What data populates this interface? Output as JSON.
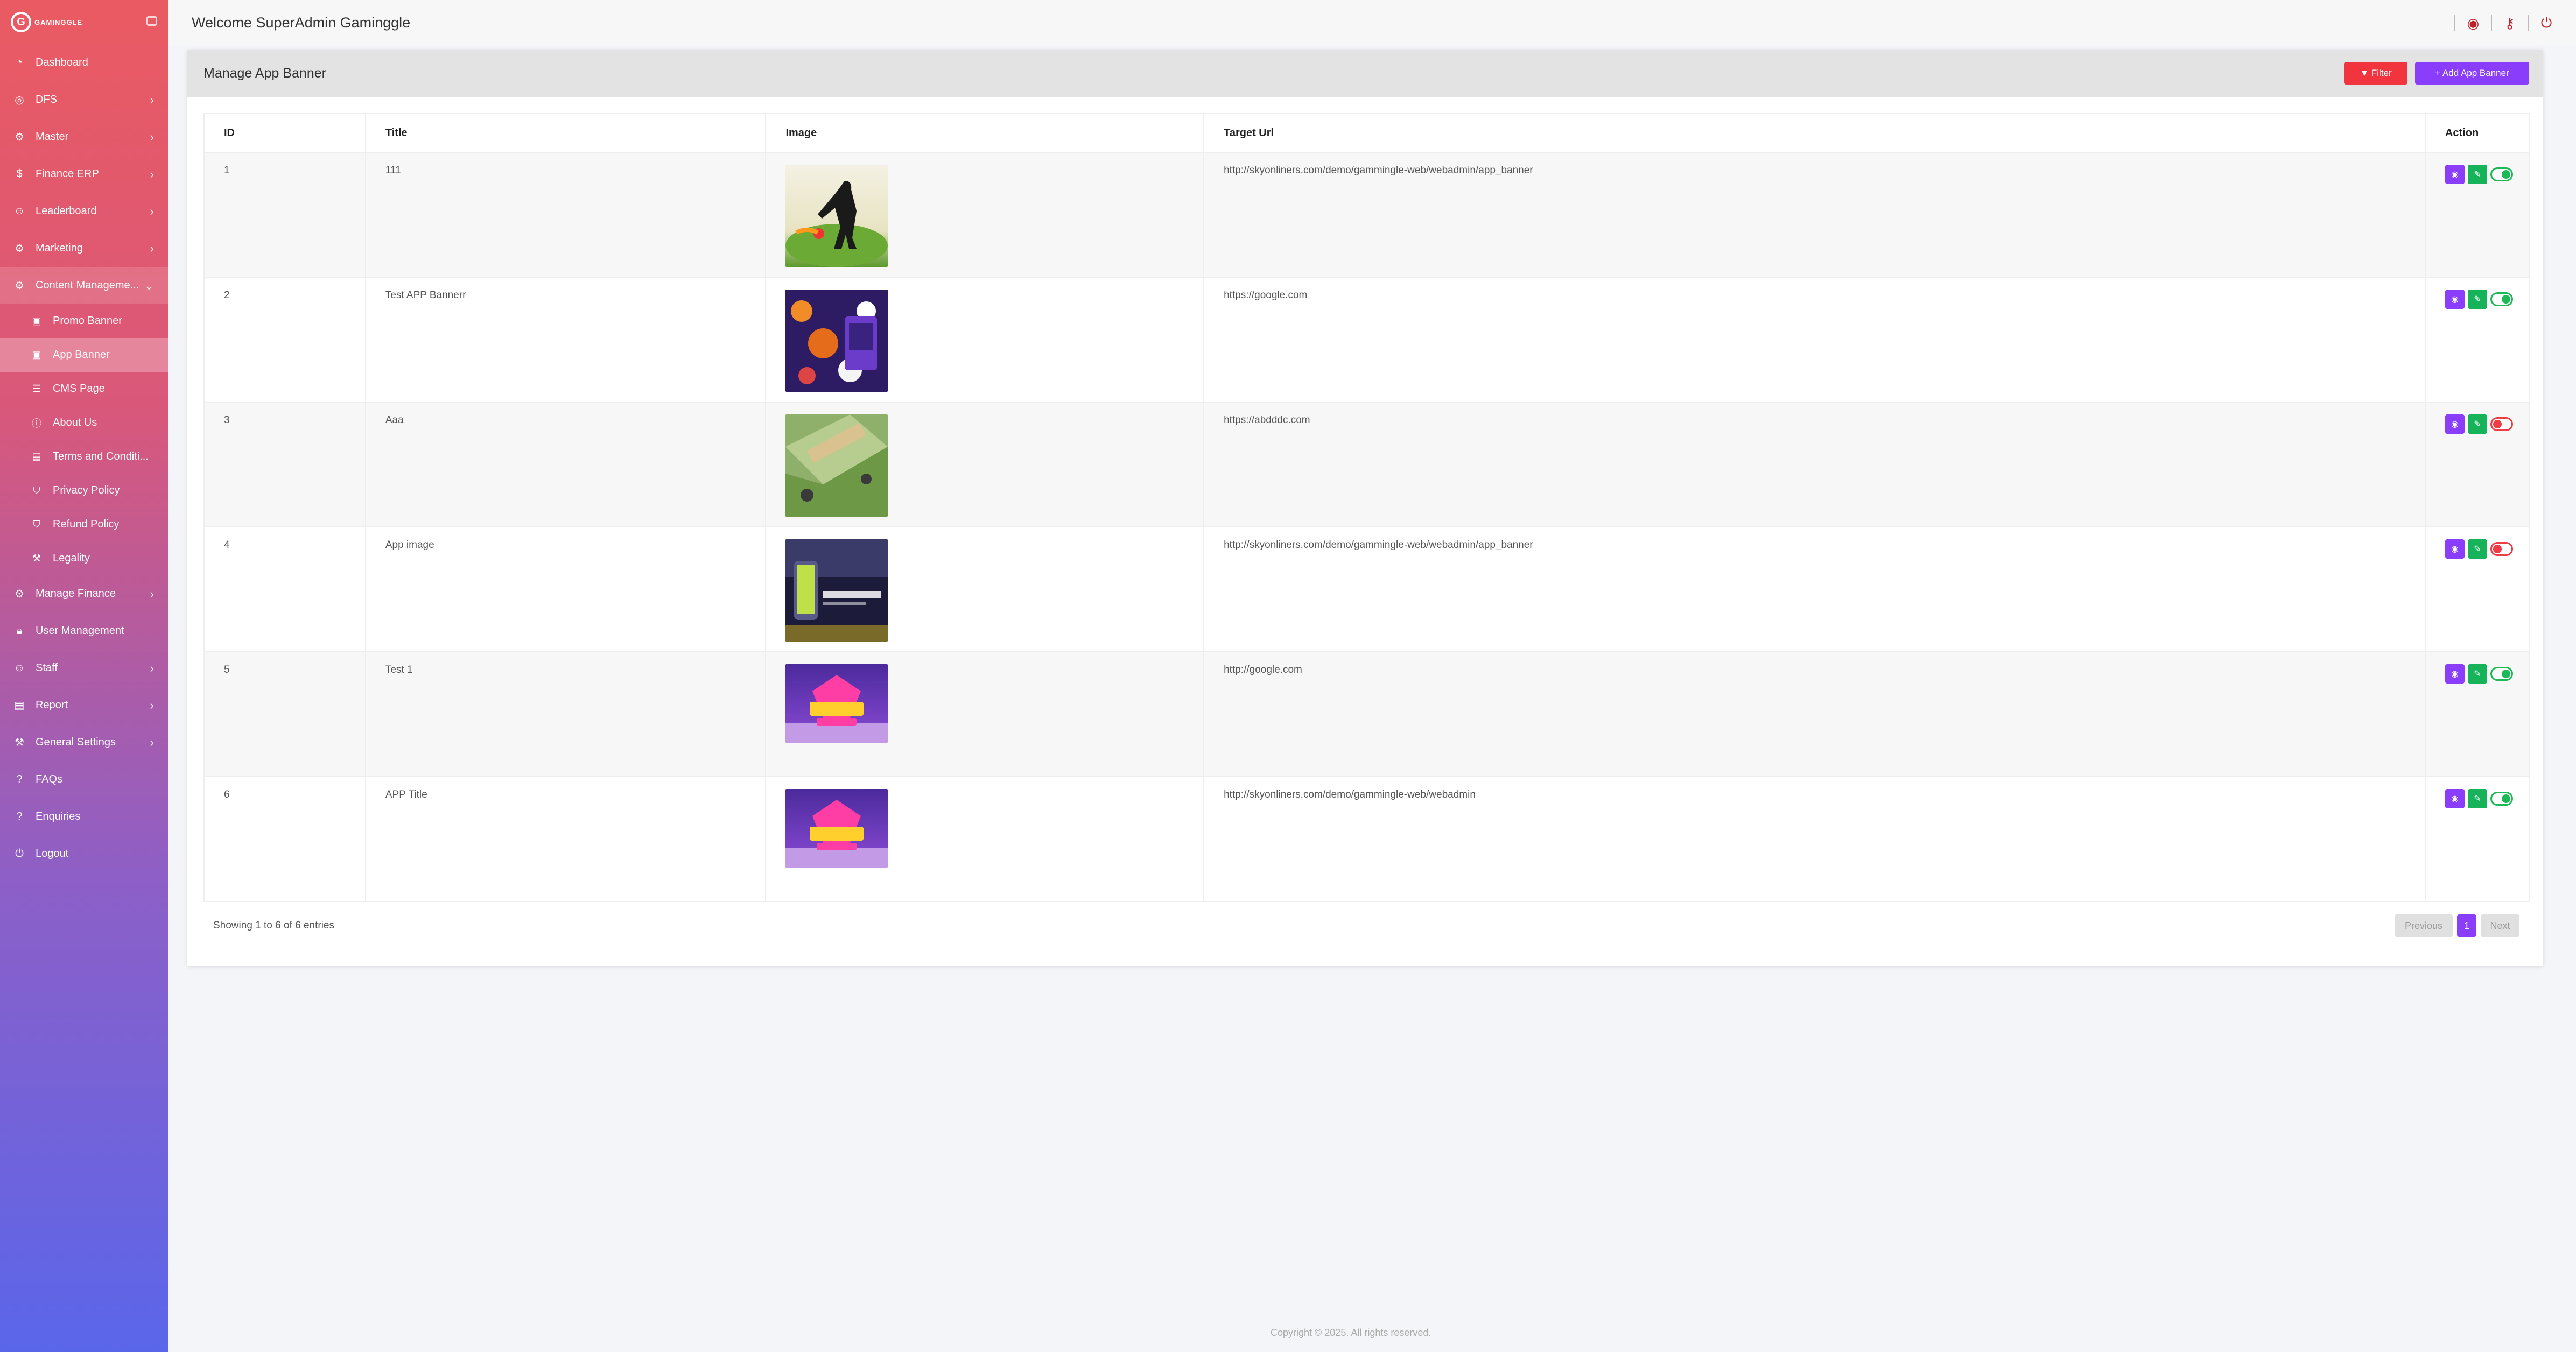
{
  "brand": {
    "logo_letter": "G",
    "name": "GAMINGGLE"
  },
  "header": {
    "welcome": "Welcome SuperAdmin Gaminggle"
  },
  "sidebar": {
    "items": [
      {
        "label": "Dashboard",
        "icon": "dashboard-icon"
      },
      {
        "label": "DFS",
        "icon": "dfs-icon"
      },
      {
        "label": "Master",
        "icon": "gears-icon"
      },
      {
        "label": "Finance ERP",
        "icon": "dollar-icon"
      },
      {
        "label": "Leaderboard",
        "icon": "users-icon"
      },
      {
        "label": "Marketing",
        "icon": "gears-icon"
      },
      {
        "label": "Content Manageme...",
        "icon": "gears-icon"
      },
      {
        "label": "Manage Finance",
        "icon": "gears-icon"
      },
      {
        "label": "User Management",
        "icon": "lock-icon"
      },
      {
        "label": "Staff",
        "icon": "user-icon"
      },
      {
        "label": "Report",
        "icon": "report-icon"
      },
      {
        "label": "General Settings",
        "icon": "wrench-icon"
      },
      {
        "label": "FAQs",
        "icon": "question-icon"
      },
      {
        "label": "Enquiries",
        "icon": "question-icon"
      },
      {
        "label": "Logout",
        "icon": "power-icon"
      }
    ],
    "content_sub": [
      {
        "label": "Promo Banner",
        "icon": "image-icon"
      },
      {
        "label": "App Banner",
        "icon": "image-icon"
      },
      {
        "label": "CMS Page",
        "icon": "list-icon"
      },
      {
        "label": "About Us",
        "icon": "info-icon"
      },
      {
        "label": "Terms and Conditi...",
        "icon": "document-icon"
      },
      {
        "label": "Privacy Policy",
        "icon": "shield-icon"
      },
      {
        "label": "Refund Policy",
        "icon": "shield-icon"
      },
      {
        "label": "Legality",
        "icon": "gavel-icon"
      }
    ]
  },
  "page": {
    "title": "Manage App Banner",
    "filter_label": "Filter",
    "add_label": "+ Add App Banner"
  },
  "table": {
    "columns": [
      "ID",
      "Title",
      "Image",
      "Target Url",
      "Action"
    ],
    "rows": [
      {
        "id": "1",
        "title": "111",
        "url": "http://skyonliners.com/demo/gammingle-web/webadmin/app_banner",
        "active": true,
        "image": "cricket-player-image"
      },
      {
        "id": "2",
        "title": "Test APP Bannerr",
        "url": "https://google.com",
        "active": true,
        "image": "sports-betting-image"
      },
      {
        "id": "3",
        "title": "Aaa",
        "url": "https://abdddc.com",
        "active": false,
        "image": "cricket-field-image"
      },
      {
        "id": "4",
        "title": "App image",
        "url": "http://skyonliners.com/demo/gammingle-web/webadmin/app_banner",
        "active": false,
        "image": "fantasy-cricket-apps-image"
      },
      {
        "id": "5",
        "title": "Test 1",
        "url": "http://google.com",
        "active": true,
        "image": "fantasy-league-image"
      },
      {
        "id": "6",
        "title": "APP Title",
        "url": "http://skyonliners.com/demo/gammingle-web/webadmin",
        "active": true,
        "image": "fantasy-league-image"
      }
    ]
  },
  "pagination": {
    "info": "Showing 1 to 6 of 6 entries",
    "previous": "Previous",
    "page": "1",
    "next": "Next"
  },
  "footer": {
    "copyright": "Copyright © 2025. All rights reserved."
  },
  "colors": {
    "primary": "#8a3dfb",
    "danger": "#f2343e",
    "success": "#16b35a"
  }
}
